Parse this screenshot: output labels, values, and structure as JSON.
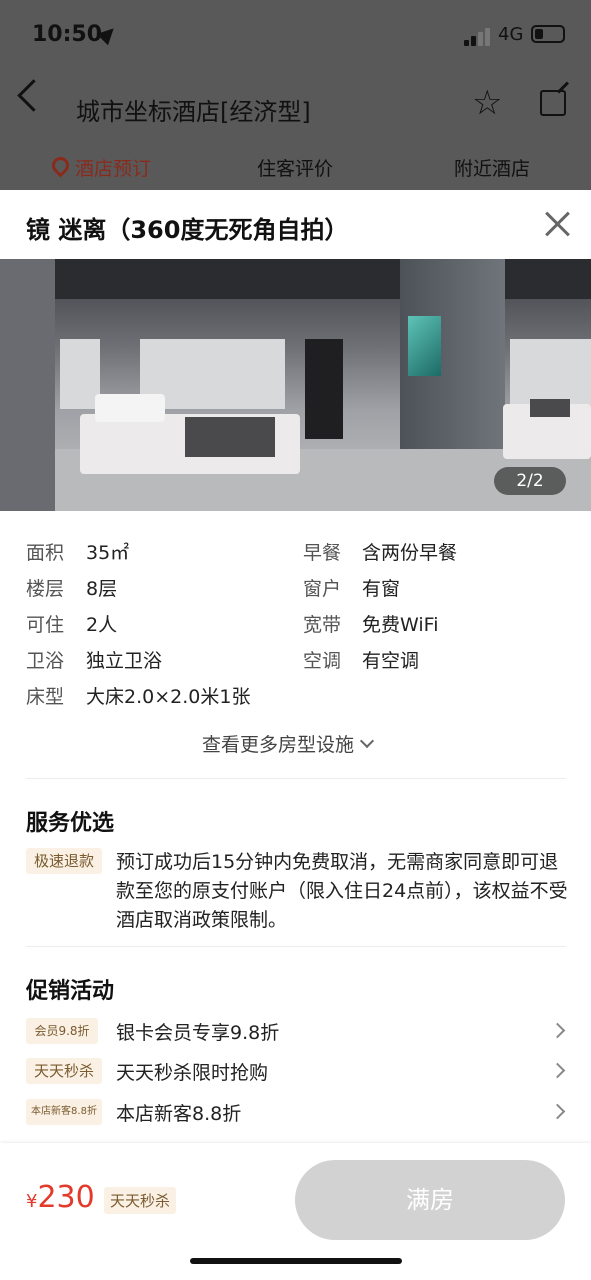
{
  "status_bar": {
    "time": "10:50",
    "network": "4G"
  },
  "header": {
    "title": "城市坐标酒店[经济型]"
  },
  "tabs": [
    {
      "label": "酒店预订",
      "active": true
    },
    {
      "label": "住客评价",
      "active": false
    },
    {
      "label": "附近酒店",
      "active": false
    }
  ],
  "room": {
    "title": "镜 迷离（360度无死角自拍）",
    "photo_counter": "2/2"
  },
  "attributes": {
    "left": [
      {
        "label": "面积",
        "value": "35㎡"
      },
      {
        "label": "楼层",
        "value": "8层"
      },
      {
        "label": "可住",
        "value": "2人"
      },
      {
        "label": "卫浴",
        "value": "独立卫浴"
      },
      {
        "label": "床型",
        "value": "大床2.0×2.0米1张"
      }
    ],
    "right": [
      {
        "label": "早餐",
        "value": "含两份早餐"
      },
      {
        "label": "窗户",
        "value": "有窗"
      },
      {
        "label": "宽带",
        "value": "免费WiFi"
      },
      {
        "label": "空调",
        "value": "有空调"
      }
    ]
  },
  "more_facilities": "查看更多房型设施",
  "service": {
    "title": "服务优选",
    "tag": "极速退款",
    "text": "预订成功后15分钟内免费取消，无需商家同意即可退款至您的原支付账户（限入住日24点前），该权益不受酒店取消政策限制。"
  },
  "promotions": {
    "title": "促销活动",
    "items": [
      {
        "tag": "会员9.8折",
        "text": "银卡会员专享9.8折"
      },
      {
        "tag": "天天秒杀",
        "text": "天天秒杀限时抢购"
      },
      {
        "tag": "本店新客8.8折",
        "text": "本店新客8.8折"
      }
    ]
  },
  "bottom": {
    "currency": "¥",
    "price": "230",
    "price_tag": "天天秒杀",
    "button": "满房"
  }
}
